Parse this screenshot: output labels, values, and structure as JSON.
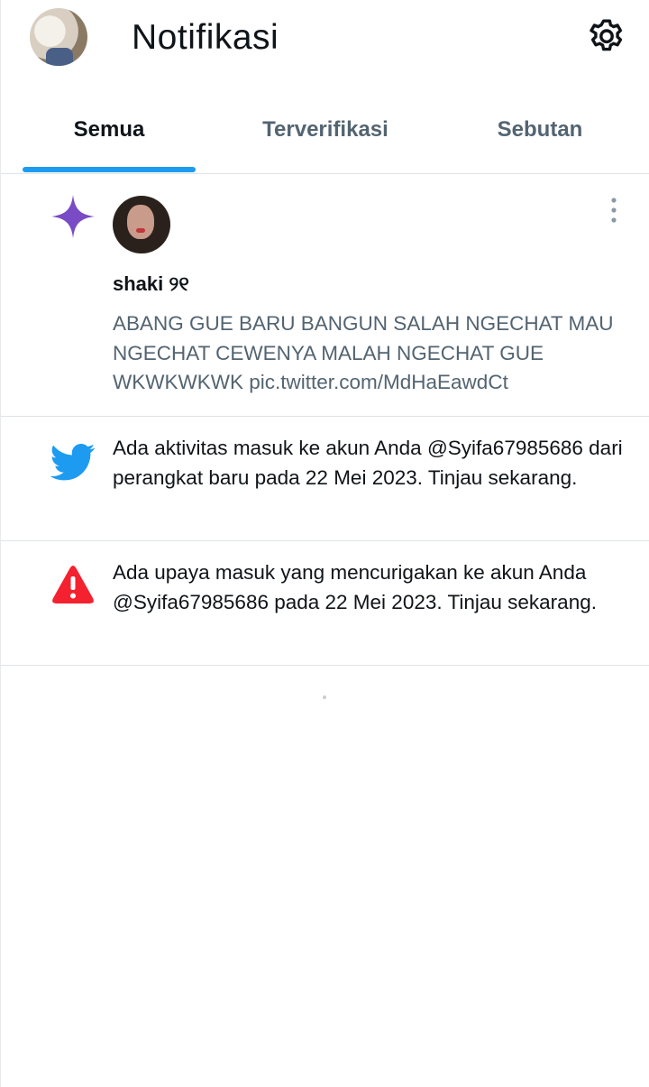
{
  "header": {
    "title": "Notifikasi",
    "settings_icon": "gear-icon"
  },
  "tabs": [
    {
      "label": "Semua",
      "active": true
    },
    {
      "label": "Terverifikasi",
      "active": false
    },
    {
      "label": "Sebutan",
      "active": false
    }
  ],
  "accent_color": "#1d9bf0",
  "notifications": [
    {
      "type": "recommended-post",
      "icon": "sparkle-icon",
      "icon_color": "#794bc4",
      "user_name": "shaki ୨୧",
      "text": "ABANG GUE BARU BANGUN SALAH NGECHAT MAU NGECHAT CEWENYA MALAH NGECHAT GUE WKWKWKWK pic.twitter.com/MdHaEawdCt"
    },
    {
      "type": "login-activity",
      "icon": "twitter-bird-icon",
      "icon_color": "#1d9bf0",
      "text": "Ada aktivitas masuk ke akun Anda @Syifa67985686 dari perangkat baru pada 22 Mei 2023. Tinjau sekarang."
    },
    {
      "type": "security-alert",
      "icon": "warning-icon",
      "icon_color": "#f4212e",
      "text": "Ada upaya masuk yang mencurigakan ke akun Anda @Syifa67985686 pada 22 Mei 2023. Tinjau sekarang."
    }
  ]
}
